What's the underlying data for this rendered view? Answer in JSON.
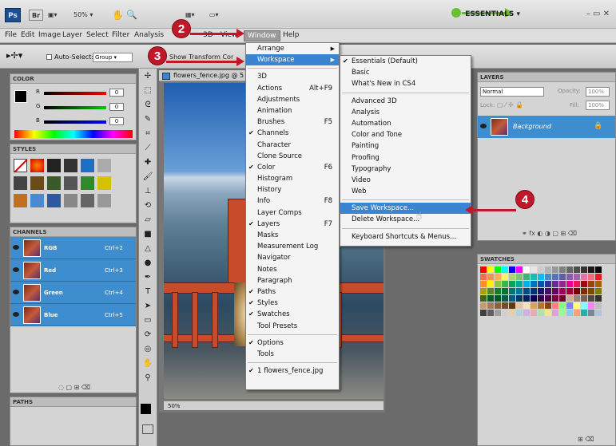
{
  "app": {
    "logo": "Ps",
    "br": "Br",
    "zoom": "50%",
    "essentials": "ESSENTIALS"
  },
  "menubar": [
    "File",
    "Edit",
    "Image",
    "Layer",
    "Select",
    "Filter",
    "Analysis",
    "3D",
    "View",
    "Window",
    "Help"
  ],
  "options": {
    "autoselect": "Auto-Select:",
    "group": "Group",
    "transform": "Show Transform Controls"
  },
  "color_panel": {
    "title": "COLOR",
    "r": "0",
    "g": "0",
    "b": "0",
    "rl": "R",
    "gl": "G",
    "bl": "B"
  },
  "styles_panel": {
    "title": "STYLES"
  },
  "channels_panel": {
    "title": "CHANNELS",
    "rows": [
      {
        "name": "RGB",
        "shortcut": "Ctrl+2"
      },
      {
        "name": "Red",
        "shortcut": "Ctrl+3"
      },
      {
        "name": "Green",
        "shortcut": "Ctrl+4"
      },
      {
        "name": "Blue",
        "shortcut": "Ctrl+5"
      }
    ]
  },
  "paths_panel": {
    "title": "PATHS"
  },
  "document": {
    "tab": "flowers_fence.jpg @ 5",
    "zoom": "50%"
  },
  "window_menu": {
    "items": [
      {
        "label": "Arrange",
        "arrow": true
      },
      {
        "label": "Workspace",
        "arrow": true,
        "highlight": true
      },
      {
        "sep": true
      },
      {
        "label": "3D"
      },
      {
        "label": "Actions",
        "sc": "Alt+F9"
      },
      {
        "label": "Adjustments"
      },
      {
        "label": "Animation"
      },
      {
        "label": "Brushes",
        "sc": "F5"
      },
      {
        "label": "Channels",
        "check": true
      },
      {
        "label": "Character"
      },
      {
        "label": "Clone Source"
      },
      {
        "label": "Color",
        "sc": "F6",
        "check": true
      },
      {
        "label": "Histogram"
      },
      {
        "label": "History"
      },
      {
        "label": "Info",
        "sc": "F8"
      },
      {
        "label": "Layer Comps"
      },
      {
        "label": "Layers",
        "sc": "F7",
        "check": true
      },
      {
        "label": "Masks"
      },
      {
        "label": "Measurement Log"
      },
      {
        "label": "Navigator"
      },
      {
        "label": "Notes"
      },
      {
        "label": "Paragraph"
      },
      {
        "label": "Paths",
        "check": true
      },
      {
        "label": "Styles",
        "check": true
      },
      {
        "label": "Swatches",
        "check": true
      },
      {
        "label": "Tool Presets"
      },
      {
        "sep": true
      },
      {
        "label": "Options",
        "check": true
      },
      {
        "label": "Tools"
      },
      {
        "sep": true
      },
      {
        "label": "1 flowers_fence.jpg",
        "check": true
      }
    ]
  },
  "workspace_menu": {
    "items": [
      {
        "label": "Essentials (Default)",
        "check": true
      },
      {
        "label": "Basic"
      },
      {
        "label": "What's New in CS4"
      },
      {
        "sep": true
      },
      {
        "label": "Advanced 3D"
      },
      {
        "label": "Analysis"
      },
      {
        "label": "Automation"
      },
      {
        "label": "Color and Tone"
      },
      {
        "label": "Painting"
      },
      {
        "label": "Proofing"
      },
      {
        "label": "Typography"
      },
      {
        "label": "Video"
      },
      {
        "label": "Web"
      },
      {
        "sep": true
      },
      {
        "label": "Save Workspace...",
        "highlight": true
      },
      {
        "label": "Delete Workspace..."
      },
      {
        "sep": true
      },
      {
        "label": "Keyboard Shortcuts & Menus..."
      }
    ]
  },
  "layers_panel": {
    "title": "LAYERS",
    "blend": "Normal",
    "opacity": "Opacity:",
    "opacity_val": "100%",
    "lock": "Lock:",
    "fill": "Fill:",
    "fill_val": "100%",
    "layer": "Background"
  },
  "swatches_panel": {
    "title": "SWATCHES"
  },
  "callouts": [
    "2",
    "3",
    "4"
  ]
}
